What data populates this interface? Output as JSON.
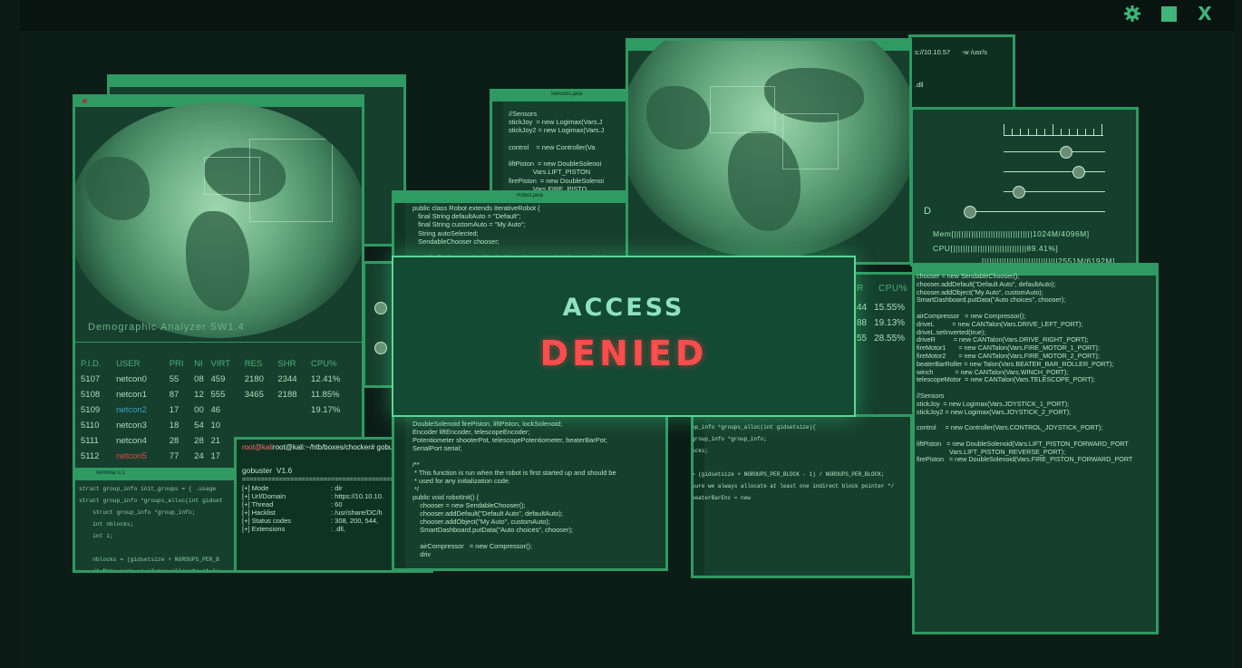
{
  "topbar": {
    "icons": [
      "gear-icon",
      "square-icon",
      "close-icon"
    ],
    "close_glyph": "X",
    "square_glyph": "■",
    "gear_glyph": "⚙"
  },
  "colors": {
    "accent": "#2f9a62",
    "background": "#0c1d17",
    "denied": "#ff4d4d",
    "access": "#8fe2bf"
  },
  "dialog": {
    "line1": "ACCESS",
    "line2": "DENIED"
  },
  "analyzer": {
    "label": "Demographic Analyzer   SW1.4",
    "columns": [
      "P.I.D.",
      "USER",
      "PRI",
      "NI",
      "VIRT",
      "RES",
      "SHR",
      "CPU%"
    ],
    "rows": [
      [
        "5107",
        "netcon0",
        "55",
        "08",
        "459",
        "2180",
        "2344",
        "12.41%"
      ],
      [
        "5108",
        "netcon1",
        "87",
        "12",
        "555",
        "3465",
        "2188",
        "11.85%"
      ],
      [
        "5109",
        "netcon2",
        "17",
        "00",
        "46",
        "",
        "",
        "19.17%"
      ],
      [
        "5110",
        "netcon3",
        "18",
        "54",
        "10",
        "",
        "",
        ""
      ],
      [
        "5111",
        "netcon4",
        "28",
        "28",
        "21",
        "",
        "",
        ""
      ],
      [
        "5112",
        "netcon5",
        "77",
        "24",
        "17",
        "",
        "",
        ""
      ]
    ]
  },
  "terminal": {
    "title": "Terminal 0.1",
    "lines": [
      "struct group_info init_groups = { .usage",
      "struct group_info *groups_alloc(int gidset",
      "    struct group_info *group_info;",
      "    int nblocks;",
      "    int i;",
      "",
      "    nblocks = (gidsetsize + NGROUPS_PER_B",
      "    /* Make sure we always allocate at le"
    ]
  },
  "gobuster": {
    "prompt": "root@kali:~/htb/boxes/chocker# gobuster",
    "title": "gobuster  V1.6",
    "separator": "=========================================",
    "rows": [
      [
        "[+] Mode",
        ": dir"
      ],
      [
        "[+] Url/Domain",
        ": https://10.10.10."
      ],
      [
        "[+] Thread",
        ": 60"
      ],
      [
        "[+] Hacklist",
        ": /usr/share/DC/h"
      ],
      [
        "[+] Status codes",
        ": 308, 200, 544,"
      ],
      [
        "[+] Extensions",
        ": .dll,"
      ]
    ]
  },
  "sensors_code": {
    "title": "Sensors.java",
    "lines": [
      "//Sensors",
      "stickJoy  = new Logimax(Vars.J",
      "stickJoy2 = new Logimax(Vars.J",
      "",
      "control    = new Controller(Va",
      "",
      "liftPiston  = new DoubleSolenoi",
      "             Vars.LIFT_PISTON",
      "firePiston  = new DoubleSolenoi",
      "             Vars.FIRE_PISTO"
    ]
  },
  "robot_code": {
    "title": "Robot.java",
    "lines": [
      "public class Robot extends IterativeRobot {",
      "   final String defaultAuto = \"Default\";",
      "   final String customAuto = \"My Auto\";",
      "   String autoSelected;",
      "   SendableChooser chooser;",
      "",
      "   public final NetworkTable dashboard = NetworkTable.getTable(\"SmartDash"
    ]
  },
  "robot_code_lower": {
    "lines": [
      "DoubleSolenoid firePiston, liftPiston, lockSolenoid;",
      "Encoder liftEncoder, telescopeEncoder;",
      "Potentiometer shooterPot, telescopePotentiometer, beaterBarPot;",
      "SerialPort serial;",
      "",
      "/**",
      " * This function is run when the robot is first started up and should be",
      " * used for any initialization code.",
      " */",
      "public void robotInit() {",
      "    chooser = new SendableChooser();",
      "    chooser.addDefault(\"Default Auto\", defaultAuto);",
      "    chooser.addObject(\"My Auto\", customAuto);",
      "    SmartDashboard.putData(\"Auto choices\", chooser);",
      "",
      "    airCompressor   = new Compressor();",
      "    driv"
    ]
  },
  "groups_code": {
    "lines": [
      "up_info *groups_alloc(int gidsetsize){",
      "group_info *group_info;",
      "ocks;",
      "",
      "= (gidsetsize + NGROUPS_PER_BLOCK - 1) / NGROUPS_PER_BLOCK;",
      "sure we always allocate at least one indirect block pointer */",
      "beaterBarEnc = new"
    ]
  },
  "url_panel": {
    "lines": [
      "s://10.10.57      -w /usr/s",
      "",
      ".dll",
      "",
      ".py"
    ]
  },
  "monitor": {
    "cpu_header": "CPU%",
    "r_header": "R",
    "values": [
      [
        "44",
        "15.55%"
      ],
      [
        "88",
        "19.13%"
      ],
      [
        "55",
        "28.55%"
      ]
    ],
    "mem": "Mem[||||||||||||||||||||||||||||||||1024M/4096M]",
    "cpu": "CPU[||||||||||||||||||||||||||||||89.41%]",
    "swp": "[||||||||||||||||||||||||||||||2551M/6192M]",
    "d_label": "D",
    "sliders": [
      0.35,
      0.42,
      0.12,
      0.15
    ]
  },
  "right_code": {
    "lines": [
      "chooser = new SendableChooser();",
      "chooser.addDefault(\"Default Auto\", defaultAuto);",
      "chooser.addObject(\"My Auto\", customAuto);",
      "SmartDashboard.putData(\"Auto choices\", chooser);",
      "",
      "airCompressor   = new Compressor();",
      "driveL          = new CANTalon(Vars.DRIVE_LEFT_PORT);",
      "driveL.setInverted(true);",
      "driveR          = new CANTalon(Vars.DRIVE_RIGHT_PORT);",
      "fireMotor1       = new CANTalon(Vars.FIRE_MOTOR_1_PORT);",
      "fireMotor2       = new CANTalon(Vars.FIRE_MOTOR_2_PORT);",
      "beaterBarRoller = new Talon(Vars.BEATER_BAR_ROLLER_PORT);",
      "winch            = new CANTalon(Vars.WINCH_PORT);",
      "telescopeMotor  = new CANTalon(Vars.TELESCOPE_PORT);",
      "",
      "//Sensors",
      "stickJoy  = new Logimax(Vars.JOYSTICK_1_PORT);",
      "stickJoy2 = new Logimax(Vars.JOYSTICK_2_PORT);",
      "",
      "control     = new Controller(Vars.CONTROL_JOYSTICK_PORT);",
      "",
      "liftPiston   = new DoubleSolenoid(Vars.LIFT_PISTON_FORWARD_PORT",
      "                  Vars.LIFT_PISTON_REVERSE_PORT);",
      "firePiston   = new DoubleSolenoid(Vars.FIRE_PISTON_FORWARD_PORT"
    ]
  }
}
